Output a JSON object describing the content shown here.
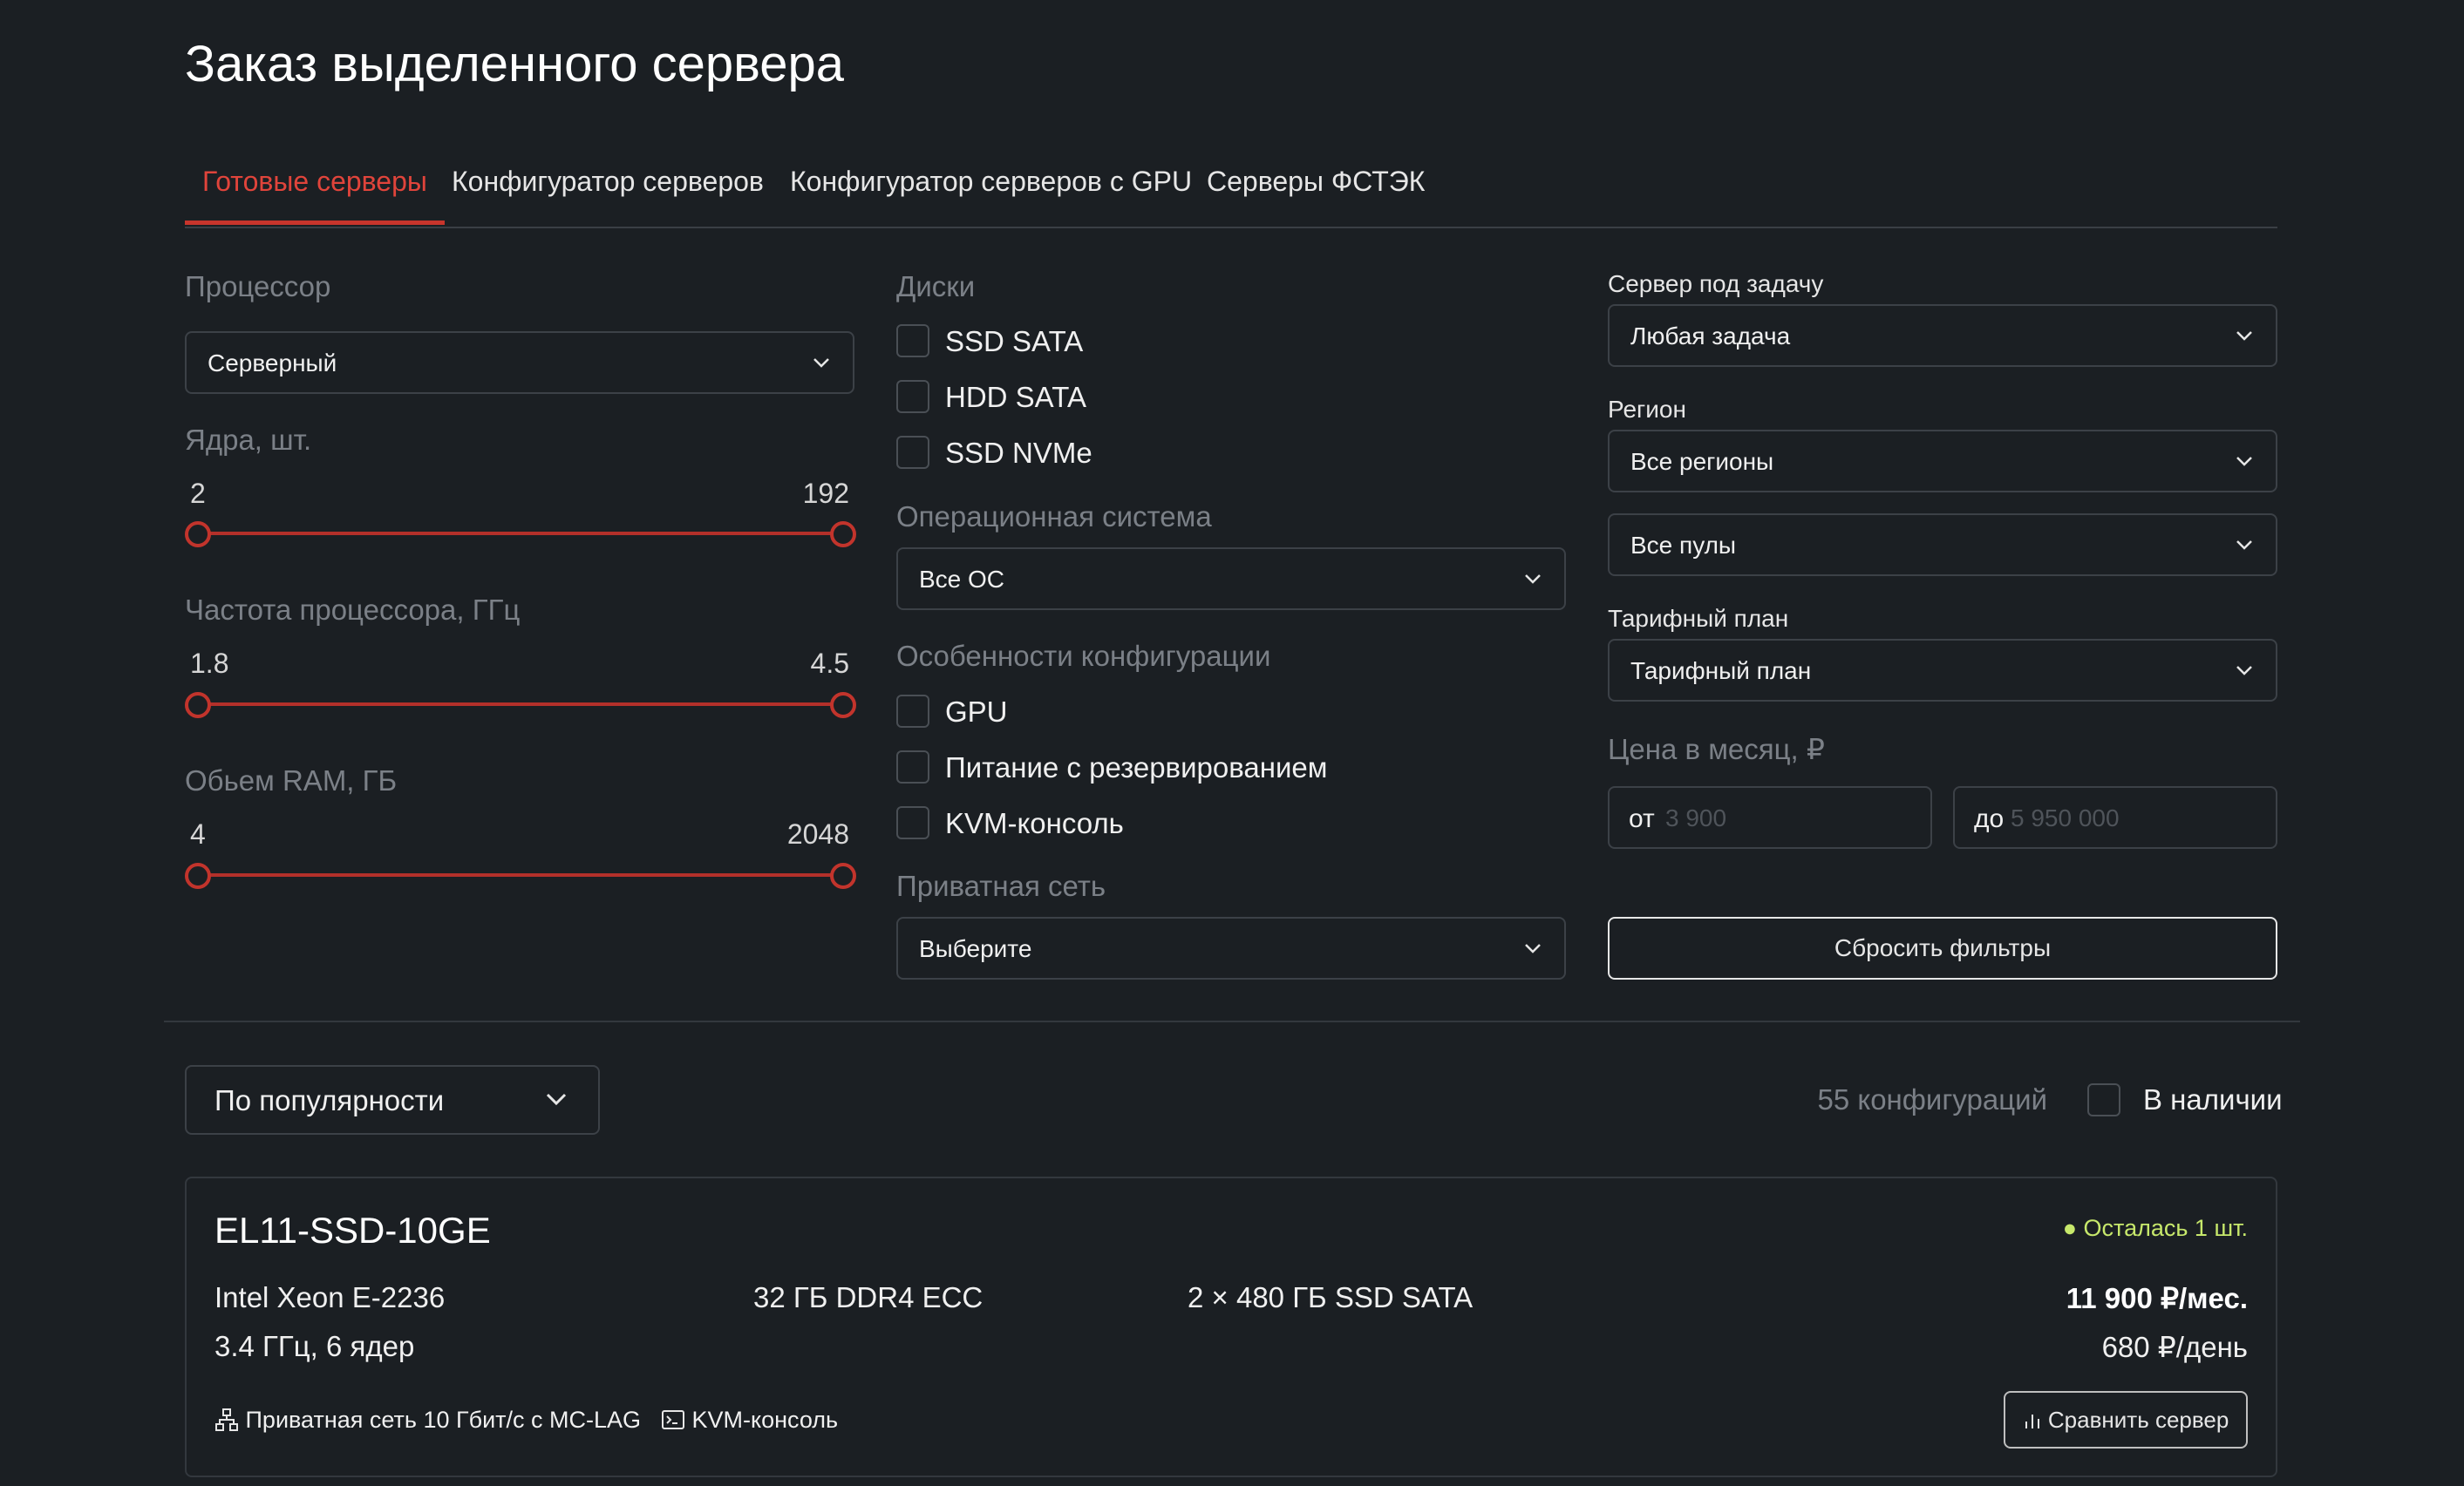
{
  "page": {
    "title": "Заказ выделенного сервера"
  },
  "tabs": [
    {
      "label": "Готовые серверы",
      "active": true
    },
    {
      "label": "Конфигуратор серверов",
      "active": false
    },
    {
      "label": "Конфигуратор серверов с GPU",
      "active": false
    },
    {
      "label": "Серверы ФСТЭК",
      "active": false
    }
  ],
  "filters": {
    "processor": {
      "label": "Процессор",
      "value": "Серверный"
    },
    "cores": {
      "label": "Ядра, шт.",
      "min": "2",
      "max": "192"
    },
    "frequency": {
      "label": "Частота процессора, ГГц",
      "min": "1.8",
      "max": "4.5"
    },
    "ram": {
      "label": "Обьем RAM, ГБ",
      "min": "4",
      "max": "2048"
    },
    "disks": {
      "label": "Диски",
      "options": [
        "SSD SATA",
        "HDD SATA",
        "SSD NVMe"
      ]
    },
    "os": {
      "label": "Операционная система",
      "value": "Все ОС"
    },
    "features": {
      "label": "Особенности конфигурации",
      "options": [
        "GPU",
        "Питание с резервированием",
        "KVM-консоль"
      ]
    },
    "private_network": {
      "label": "Приватная сеть",
      "value": "Выберите"
    },
    "task": {
      "label": "Сервер под задачу",
      "value": "Любая задача"
    },
    "region": {
      "label": "Регион",
      "value": "Все регионы",
      "pool_value": "Все пулы"
    },
    "tariff": {
      "label": "Тарифный план",
      "value": "Тарифный план"
    },
    "price": {
      "label": "Цена в месяц, ₽",
      "from_prefix": "от",
      "from_placeholder": "3 900",
      "to_prefix": "до",
      "to_placeholder": "5 950 000"
    },
    "reset_label": "Сбросить фильтры"
  },
  "listing": {
    "sort_value": "По популярности",
    "count_text": "55 конфигураций",
    "in_stock_label": "В наличии"
  },
  "server": {
    "name": "EL11-SSD-10GE",
    "stock": "Осталась 1 шт.",
    "cpu": "Intel Xeon E-2236",
    "cpu_details": "3.4 ГГц, 6 ядер",
    "ram": "32 ГБ DDR4 ECC",
    "storage": "2 × 480 ГБ SSD SATA",
    "price_month": "11 900 ₽/мес.",
    "price_day": "680 ₽/день",
    "feature_network": "Приватная сеть 10 Гбит/с с MC-LAG",
    "feature_kvm": "KVM-консоль",
    "compare_label": "Сравнить сервер"
  },
  "colors": {
    "accent": "#c8352c",
    "stock": "#c7e86b",
    "background": "#1b1f23"
  }
}
